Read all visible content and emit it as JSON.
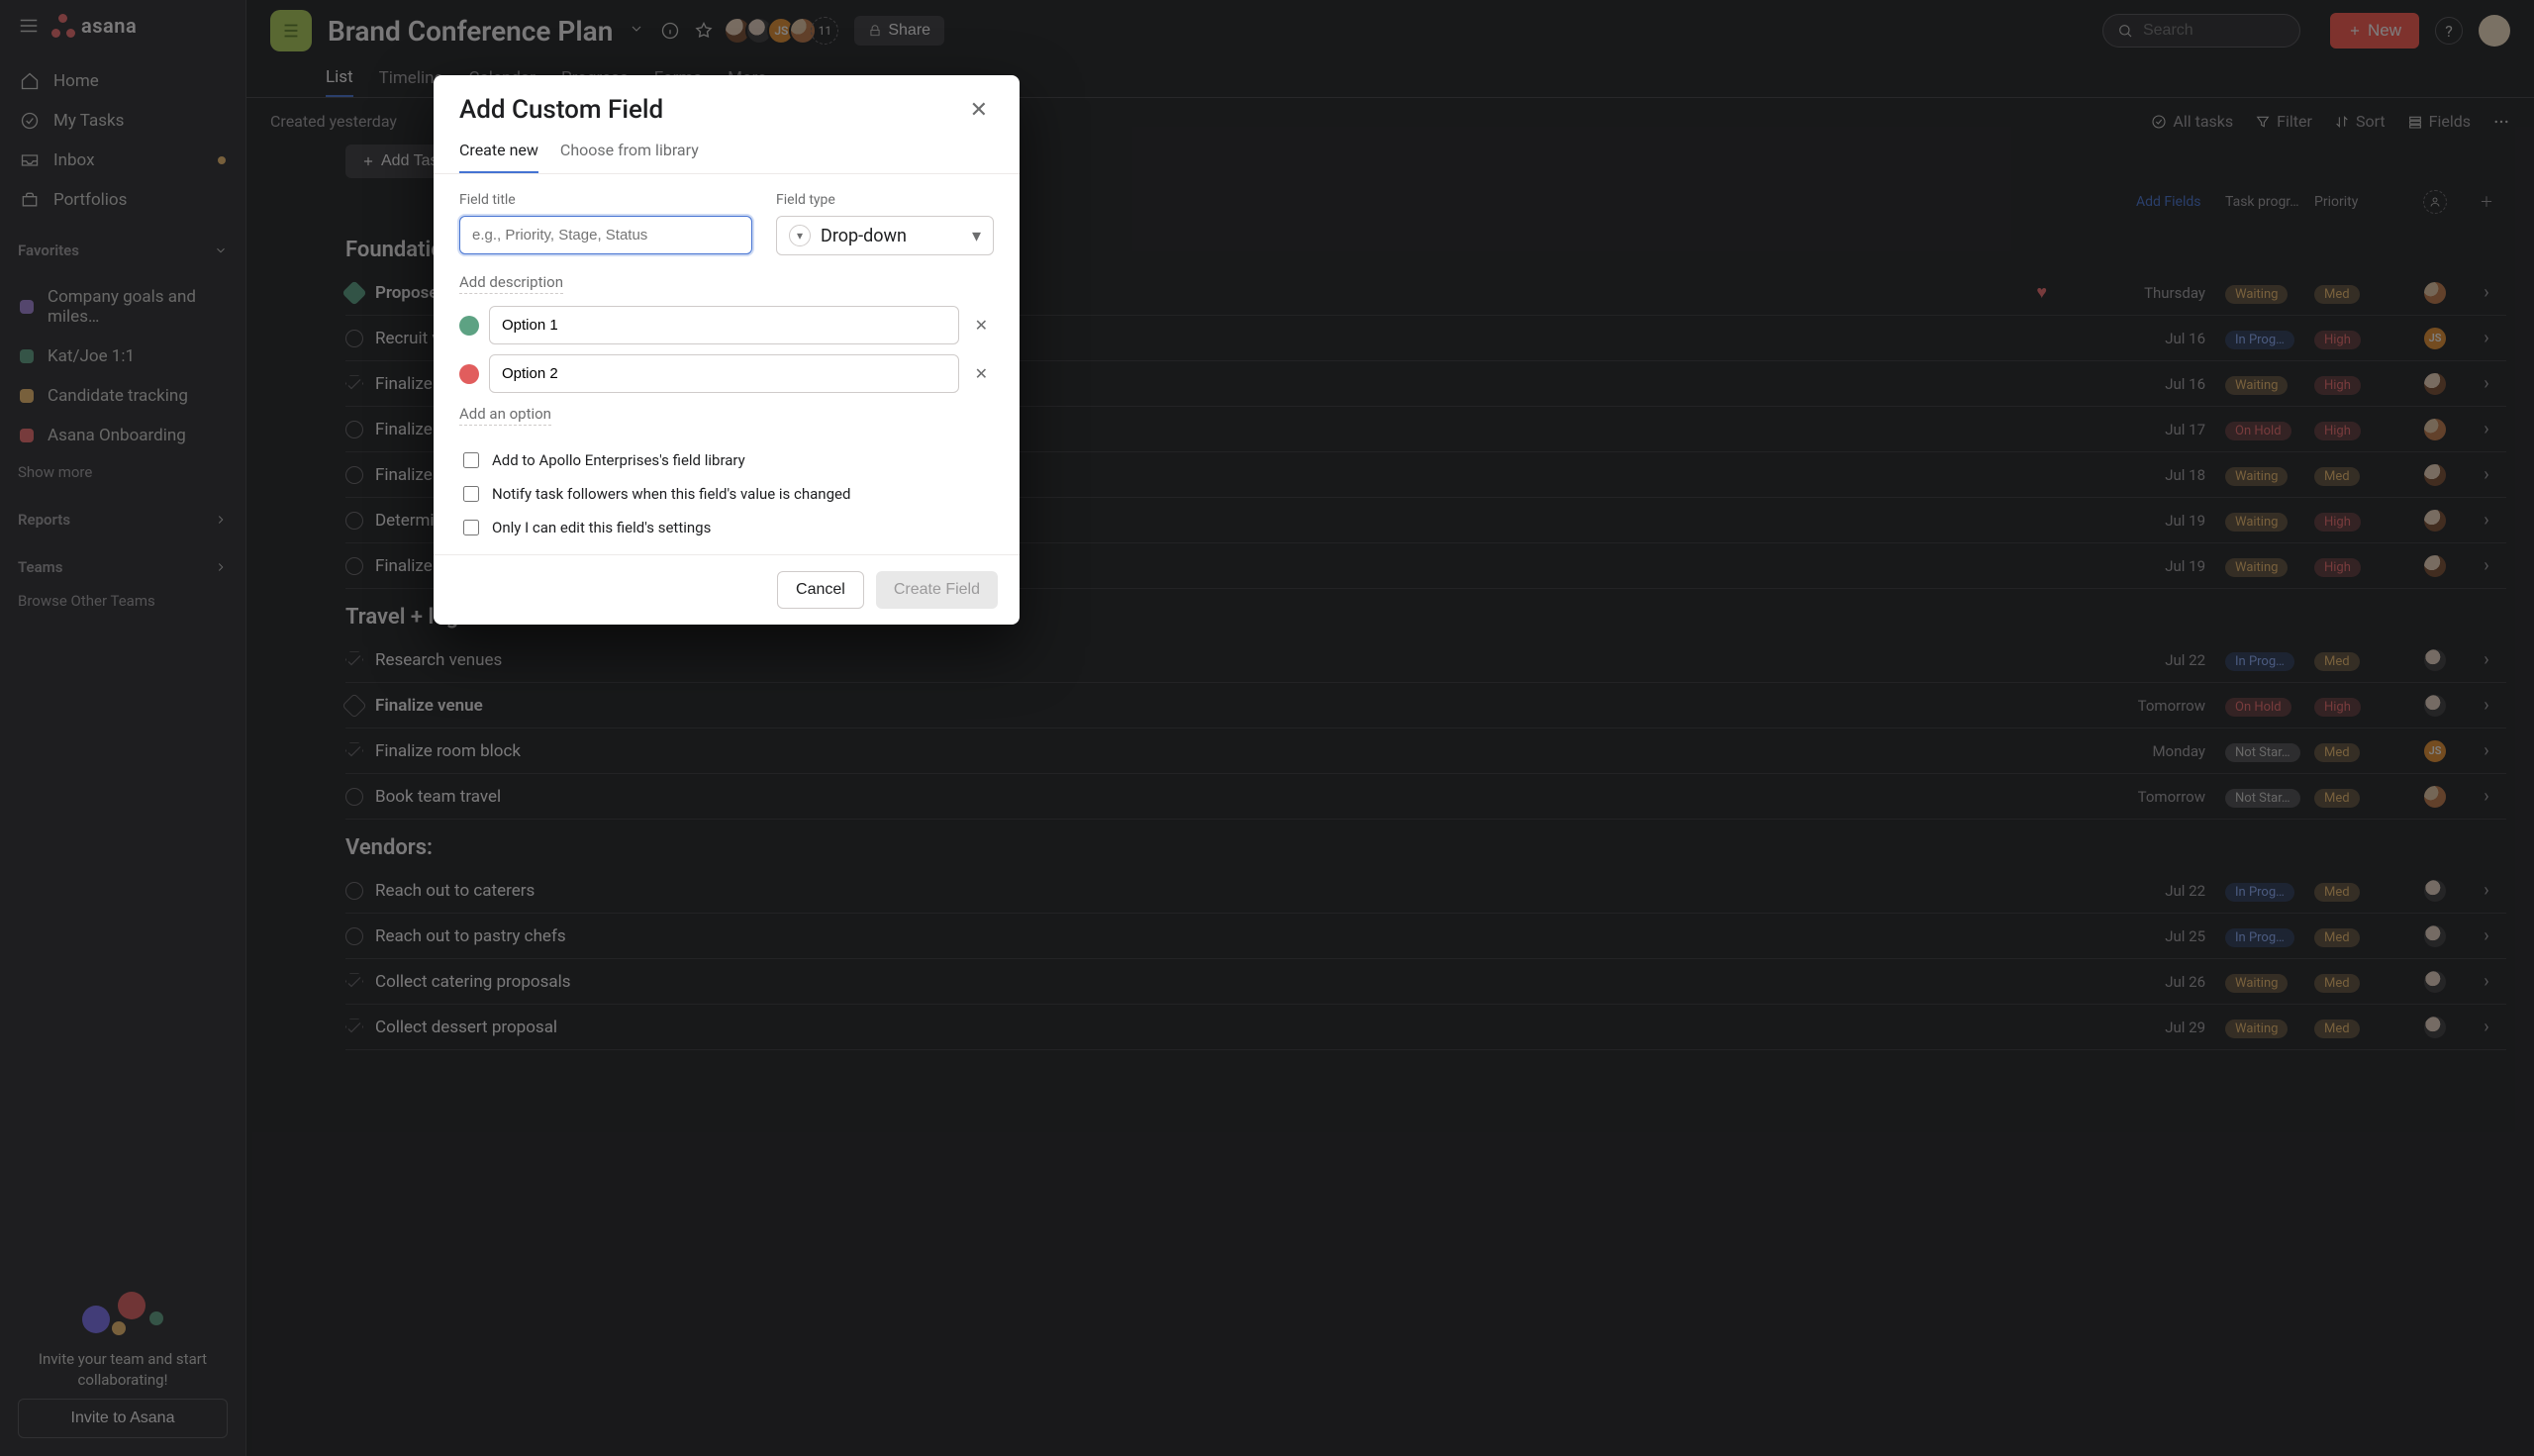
{
  "brand": {
    "name": "asana"
  },
  "sidebar": {
    "nav": [
      {
        "key": "home",
        "label": "Home"
      },
      {
        "key": "tasks",
        "label": "My Tasks"
      },
      {
        "key": "inbox",
        "label": "Inbox",
        "unread": true
      },
      {
        "key": "port",
        "label": "Portfolios"
      }
    ],
    "favorites": {
      "header": "Favorites",
      "items": [
        {
          "label": "Company goals and miles…",
          "color": "#a283d8"
        },
        {
          "label": "Kat/Joe 1:1",
          "color": "#5da283"
        },
        {
          "label": "Candidate tracking",
          "color": "#f1bd6c"
        },
        {
          "label": "Asana Onboarding",
          "color": "#f06a6a"
        }
      ]
    },
    "show_more": "Show more",
    "reports": "Reports",
    "teams": "Teams",
    "browse": "Browse Other Teams",
    "invite": {
      "text": "Invite your team and start collaborating!",
      "button": "Invite to Asana"
    }
  },
  "project": {
    "title": "Brand Conference Plan",
    "member_overflow": "11",
    "share_label": "Share",
    "tabs": [
      "List",
      "Timeline",
      "Calendar",
      "Progress",
      "Forms",
      "More…"
    ],
    "active_tab": 0
  },
  "topbar": {
    "search_placeholder": "Search",
    "new_label": "New",
    "help_glyph": "?"
  },
  "toolbar": {
    "created": "Created yesterday",
    "all_tasks": "All tasks",
    "filter": "Filter",
    "sort": "Sort",
    "fields": "Fields"
  },
  "columns": {
    "add_task": "Add Task",
    "add_fields": "Add Fields",
    "task_progress": "Task progr…",
    "priority": "Priority"
  },
  "sections": [
    {
      "title": "Foundational work:",
      "rows": [
        {
          "kind": "milestone",
          "done": true,
          "bold": true,
          "name": "Propose conference idea to execs",
          "liked": true,
          "date": "Thursday",
          "progress": "Waiting",
          "priority": "Med",
          "avatar": "image1"
        },
        {
          "kind": "task",
          "name": "Recruit volunteers to help plan",
          "date": "Jul 16",
          "progress": "In Prog…",
          "priority": "High",
          "avatar": "JS"
        },
        {
          "kind": "approval",
          "name": "Finalize conference name",
          "date": "Jul 16",
          "progress": "Waiting",
          "priority": "High",
          "avatar": "image2"
        },
        {
          "kind": "task",
          "name": "Finalize theme",
          "date": "Jul 17",
          "progress": "On Hold",
          "priority": "High",
          "avatar": "image1"
        },
        {
          "kind": "task",
          "name": "Finalize headcount",
          "date": "Jul 18",
          "progress": "Waiting",
          "priority": "Med",
          "avatar": "image2"
        },
        {
          "kind": "task",
          "name": "Determine dates",
          "date": "Jul 19",
          "progress": "Waiting",
          "priority": "High",
          "avatar": "image2"
        },
        {
          "kind": "task",
          "name": "Finalize budget",
          "date": "Jul 19",
          "progress": "Waiting",
          "priority": "High",
          "avatar": "image2"
        }
      ]
    },
    {
      "title": "Travel + logistics:",
      "rows": [
        {
          "kind": "approval",
          "name": "Research venues",
          "date": "Jul 22",
          "progress": "In Prog…",
          "priority": "Med",
          "avatar": "image3"
        },
        {
          "kind": "milestone",
          "bold": true,
          "name": "Finalize venue",
          "date": "Tomorrow",
          "progress": "On Hold",
          "priority": "High",
          "avatar": "image3"
        },
        {
          "kind": "approval",
          "name": "Finalize room block",
          "date": "Monday",
          "progress": "Not Star…",
          "priority": "Med",
          "avatar": "JS"
        },
        {
          "kind": "task",
          "name": "Book team travel",
          "date": "Tomorrow",
          "progress": "Not Star…",
          "priority": "Med",
          "avatar": "image1"
        }
      ]
    },
    {
      "title": "Vendors:",
      "rows": [
        {
          "kind": "task",
          "name": "Reach out to caterers",
          "date": "Jul 22",
          "progress": "In Prog…",
          "priority": "Med",
          "avatar": "image3"
        },
        {
          "kind": "task",
          "name": "Reach out to pastry chefs",
          "date": "Jul 25",
          "progress": "In Prog…",
          "priority": "Med",
          "avatar": "image3"
        },
        {
          "kind": "approval",
          "name": "Collect catering proposals",
          "date": "Jul 26",
          "progress": "Waiting",
          "priority": "Med",
          "avatar": "image3"
        },
        {
          "kind": "approval",
          "name": "Collect dessert proposal",
          "date": "Jul 29",
          "progress": "Waiting",
          "priority": "Med",
          "avatar": "image3"
        }
      ]
    }
  ],
  "modal": {
    "title": "Add Custom Field",
    "tabs": {
      "create": "Create new",
      "choose": "Choose from library"
    },
    "field_title_label": "Field title",
    "field_title_placeholder": "e.g., Priority, Stage, Status",
    "field_type_label": "Field type",
    "field_type_value": "Drop-down",
    "add_description": "Add description",
    "options": [
      {
        "color": "#5da283",
        "value": "Option 1"
      },
      {
        "color": "#e15d5d",
        "value": "Option 2"
      }
    ],
    "add_option": "Add an option",
    "check_library": "Add to Apollo Enterprises's field library",
    "check_notify": "Notify task followers when this field's value is changed",
    "check_onlyi": "Only I can edit this field's settings",
    "cancel": "Cancel",
    "create": "Create Field"
  }
}
